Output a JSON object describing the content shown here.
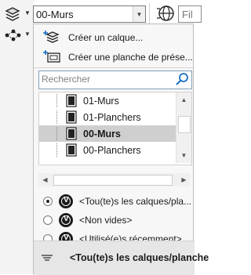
{
  "toolbar": {
    "layer_combo_value": "00-Murs",
    "right_combo_value": "Fil",
    "icons": [
      "layers-stack-icon",
      "network-icon",
      "globe-icon"
    ]
  },
  "panel": {
    "menu": [
      {
        "label": "Créer un calque...",
        "icon": "new-layer-icon"
      },
      {
        "label": "Créer une planche de prése...",
        "icon": "new-sheet-icon"
      }
    ],
    "search": {
      "placeholder": "Rechercher",
      "icon": "search-icon"
    },
    "layers": [
      {
        "name": "01-Murs",
        "selected": false
      },
      {
        "name": "01-Planchers",
        "selected": false
      },
      {
        "name": "00-Murs",
        "selected": true
      },
      {
        "name": "00-Planchers",
        "selected": false
      }
    ],
    "filters": [
      {
        "label": "<Tou(te)s les calques/pla...",
        "checked": true
      },
      {
        "label": "<Non vides>",
        "checked": false
      },
      {
        "label": "<Utilisé(e)s récemment>",
        "checked": false
      }
    ],
    "footer": {
      "label": "<Tou(te)s les calques/planche",
      "icon": "filter-list-icon"
    }
  },
  "colors": {
    "accent": "#1a6fc4",
    "selection": "#cfcfcf",
    "panel_bg": "#f7f7f7"
  }
}
